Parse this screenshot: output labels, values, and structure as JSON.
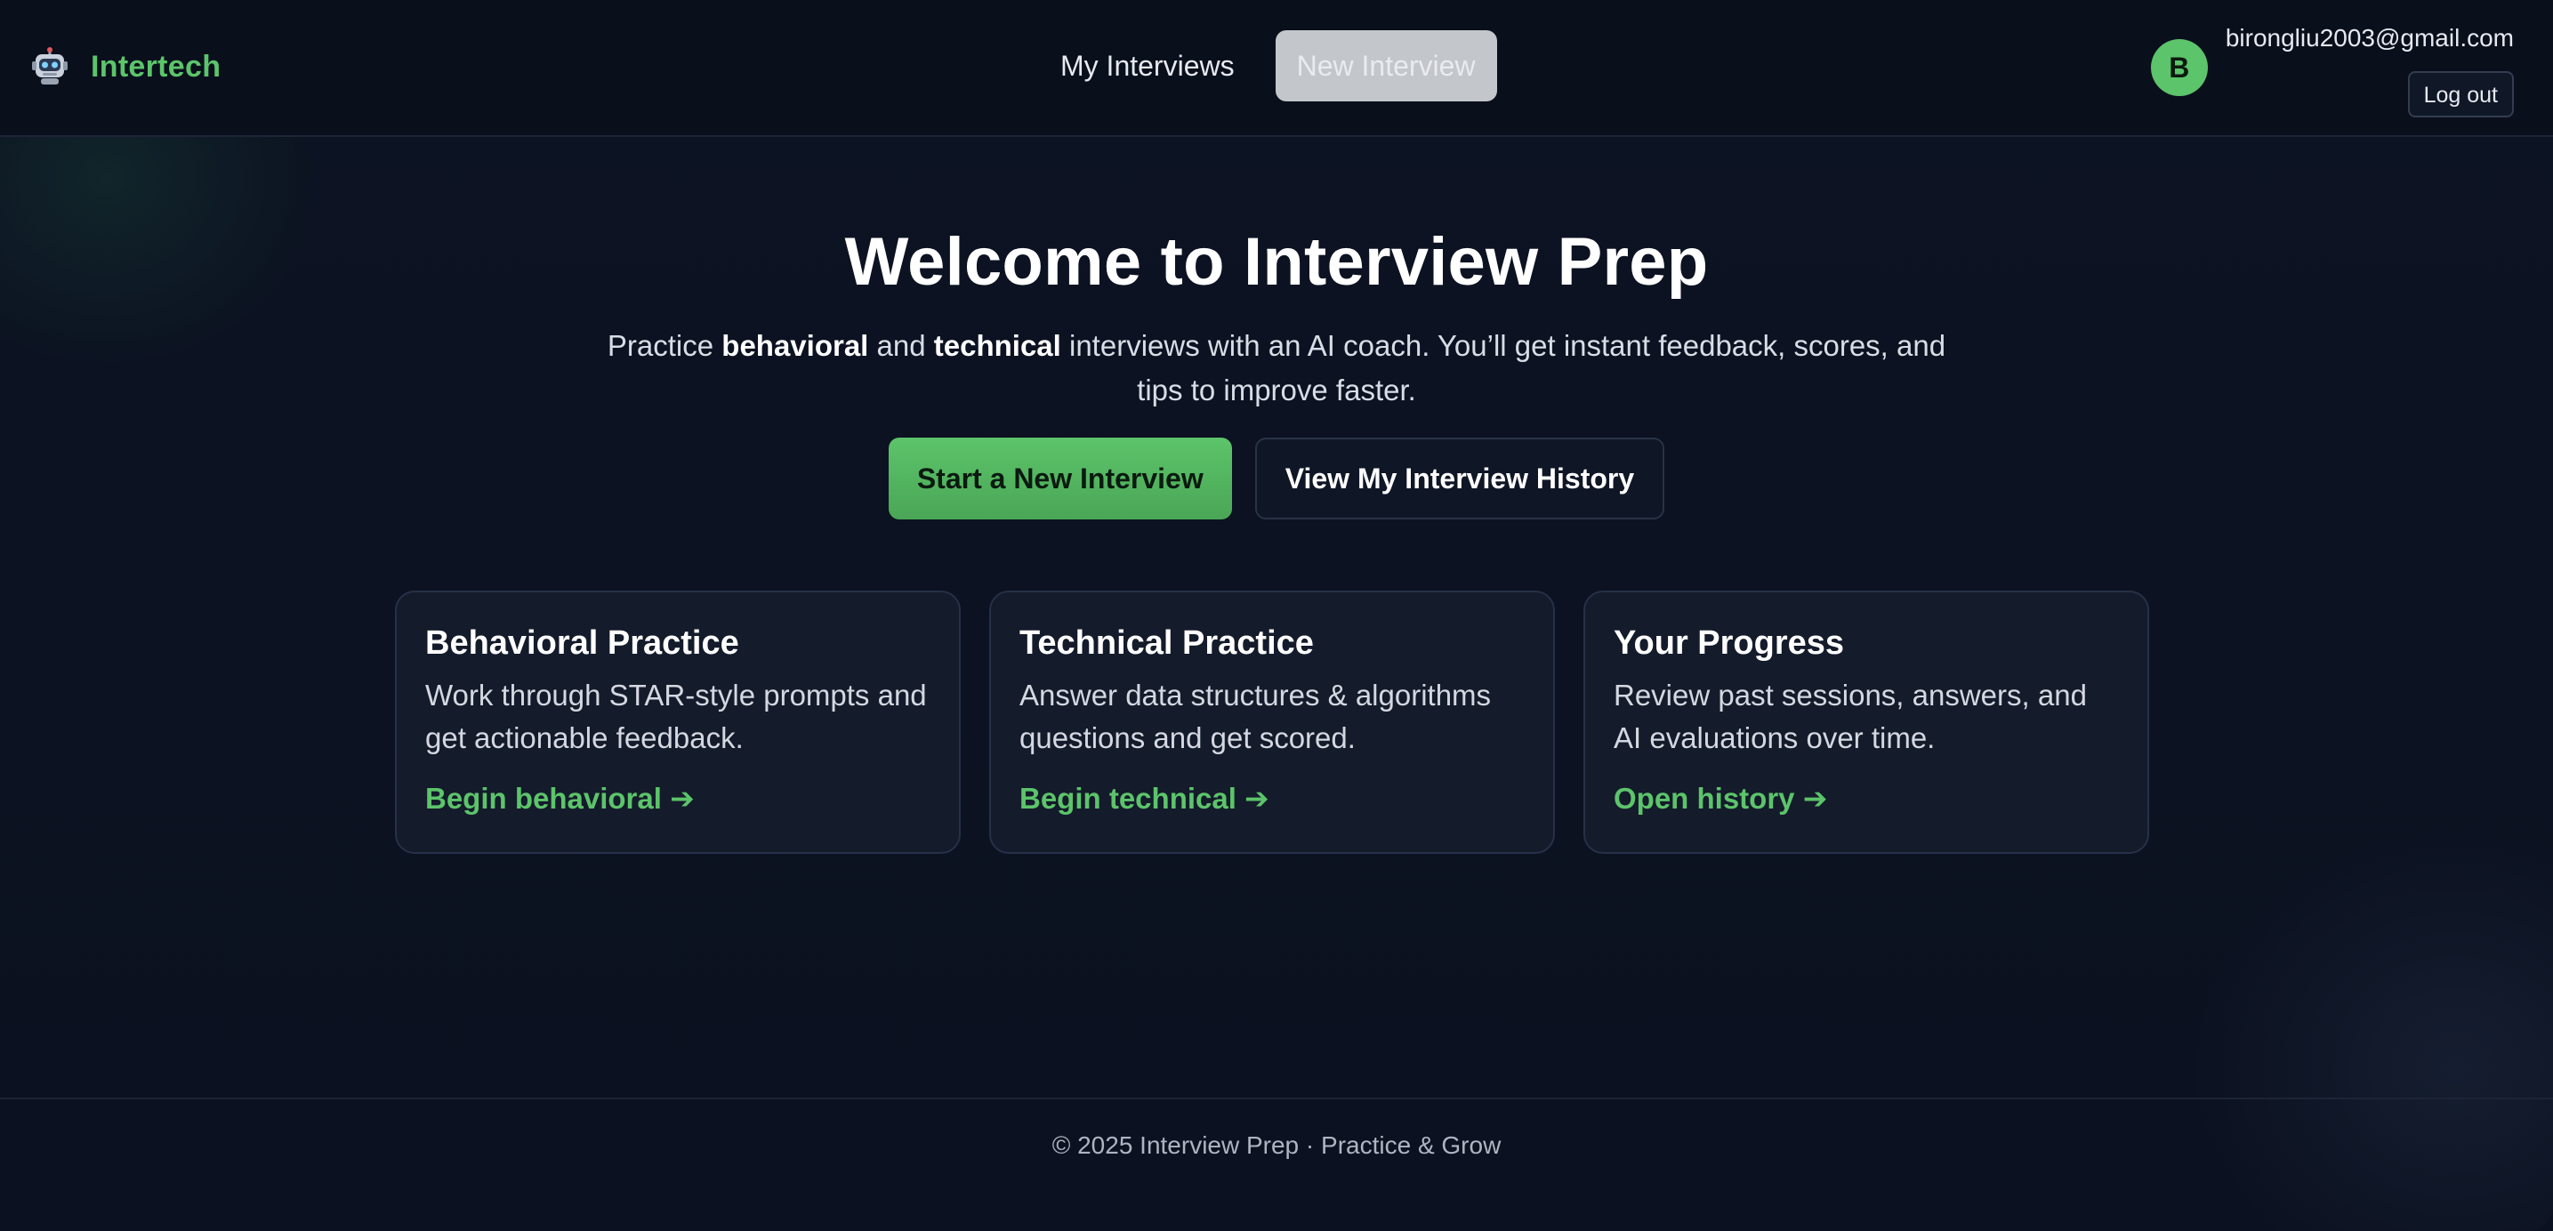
{
  "header": {
    "brand": {
      "icon": "robot-icon",
      "name": "Intertech"
    },
    "nav": {
      "my_interviews": "My Interviews",
      "new_interview": "New Interview"
    },
    "user": {
      "avatar_letter": "B",
      "email": "birongliu2003@gmail.com",
      "logout_label": "Log out"
    }
  },
  "hero": {
    "title": "Welcome to Interview Prep",
    "subtitle": {
      "part1": "Practice ",
      "bold1": "behavioral",
      "part2": " and ",
      "bold2": "technical",
      "part3": " interviews with an AI coach. You’ll get instant feedback, scores, and tips to improve faster."
    },
    "primary_cta": "Start a New Interview",
    "secondary_cta": "View My Interview History"
  },
  "cards": [
    {
      "title": "Behavioral Practice",
      "text": "Work through STAR-style prompts and get actionable feedback.",
      "link": "Begin behavioral ➔"
    },
    {
      "title": "Technical Practice",
      "text": "Answer data structures & algorithms questions and get scored.",
      "link": "Begin technical ➔"
    },
    {
      "title": "Your Progress",
      "text": "Review past sessions, answers, and AI evaluations over time.",
      "link": "Open history ➔"
    }
  ],
  "footer": {
    "text": "© 2025 Interview Prep · Practice & Grow"
  },
  "colors": {
    "accent": "#5cc46a",
    "background": "#0b1120",
    "card": "#141b2b",
    "nav_button_disabled": "#c3c6cb"
  }
}
